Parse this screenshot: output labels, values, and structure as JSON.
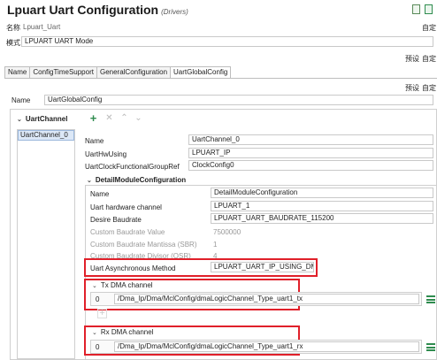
{
  "header": {
    "title": "Lpuart Uart Configuration",
    "subtitle": "(Drivers)",
    "name_label": "名称",
    "name_value": "Lpuart_Uart",
    "auto_label": "自定",
    "mode_label": "模式",
    "mode_value": "LPUART UART Mode"
  },
  "tabs": [
    {
      "label": "Name"
    },
    {
      "label": "ConfigTimeSupport"
    },
    {
      "label": "GeneralConfiguration"
    },
    {
      "label": "UartGlobalConfig"
    }
  ],
  "toolbar": {
    "preset_label": "预设",
    "auto_label": "自定"
  },
  "global_config": {
    "name_label": "Name",
    "name_value": "UartGlobalConfig"
  },
  "uart_channel": {
    "section_title": "UartChannel",
    "list_items": [
      "UartChannel_0"
    ],
    "fields": [
      {
        "label": "Name",
        "value": "UartChannel_0"
      },
      {
        "label": "UartHwUsing",
        "value": "LPUART_IP"
      },
      {
        "label": "UartClockFunctionalGroupRef",
        "value": "ClockConfig0"
      }
    ]
  },
  "detail": {
    "section_title": "DetailModuleConfiguration",
    "fields": [
      {
        "label": "Name",
        "value": "DetailModuleConfiguration",
        "disabled": false
      },
      {
        "label": "Uart hardware channel",
        "value": "LPUART_1",
        "disabled": false
      },
      {
        "label": "Desire Baudrate",
        "value": "LPUART_UART_BAUDRATE_115200",
        "disabled": false
      },
      {
        "label": "Custom Baudrate Value",
        "value": "7500000",
        "disabled": true
      },
      {
        "label": "Custom Baudrate Mantissa (SBR)",
        "value": "1",
        "disabled": true
      },
      {
        "label": "Custom Baudrate Divisor (OSR)",
        "value": "4",
        "disabled": true
      }
    ],
    "async_label": "Uart Asynchronous Method",
    "async_value": "LPUART_UART_IP_USING_DMA"
  },
  "tx_dma": {
    "section_title": "Tx DMA channel",
    "index": "0",
    "path": "/Dma_Ip/Dma/MclConfig/dmaLogicChannel_Type_uart1_tx"
  },
  "rx_dma": {
    "section_title": "Rx DMA channel",
    "index": "0",
    "path": "/Dma_Ip/Dma/MclConfig/dmaLogicChannel_Type_uart1_rx"
  },
  "colors": {
    "highlight": "#e0202a",
    "accent_green": "#2f8c4f"
  }
}
